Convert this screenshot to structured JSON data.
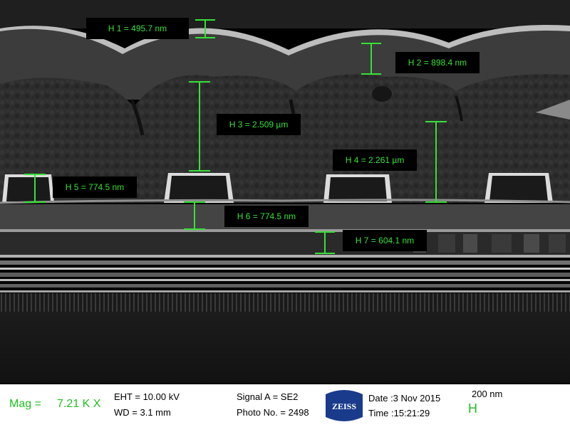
{
  "measurements": [
    {
      "name": "H 1",
      "label": "H 1 = 495.7 nm"
    },
    {
      "name": "H 2",
      "label": "H 2 = 898.4 nm"
    },
    {
      "name": "H 3",
      "label": "H 3 = 2.509 µm"
    },
    {
      "name": "H 4",
      "label": "H 4 = 2.261 µm"
    },
    {
      "name": "H 5",
      "label": "H 5 = 774.5 nm"
    },
    {
      "name": "H 6",
      "label": "H 6 = 774.5 nm"
    },
    {
      "name": "H 7",
      "label": "H 7 = 604.1 nm"
    }
  ],
  "infobar": {
    "mag_label": "Mag =",
    "mag_value": "7.21 K X",
    "eht": "EHT = 10.00 kV",
    "wd": "WD =  3.1 mm",
    "signal": "Signal A = SE2",
    "photo": "Photo No. = 2498",
    "logo_text": "ZEISS",
    "date": "Date :3 Nov 2015",
    "time": "Time :15:21:29",
    "scale_text": "200 nm",
    "scale_glyph": "H"
  },
  "colors": {
    "measure_green": "#38e038",
    "infobar_green": "#20c020",
    "zeiss_blue": "#1a3a8c"
  }
}
